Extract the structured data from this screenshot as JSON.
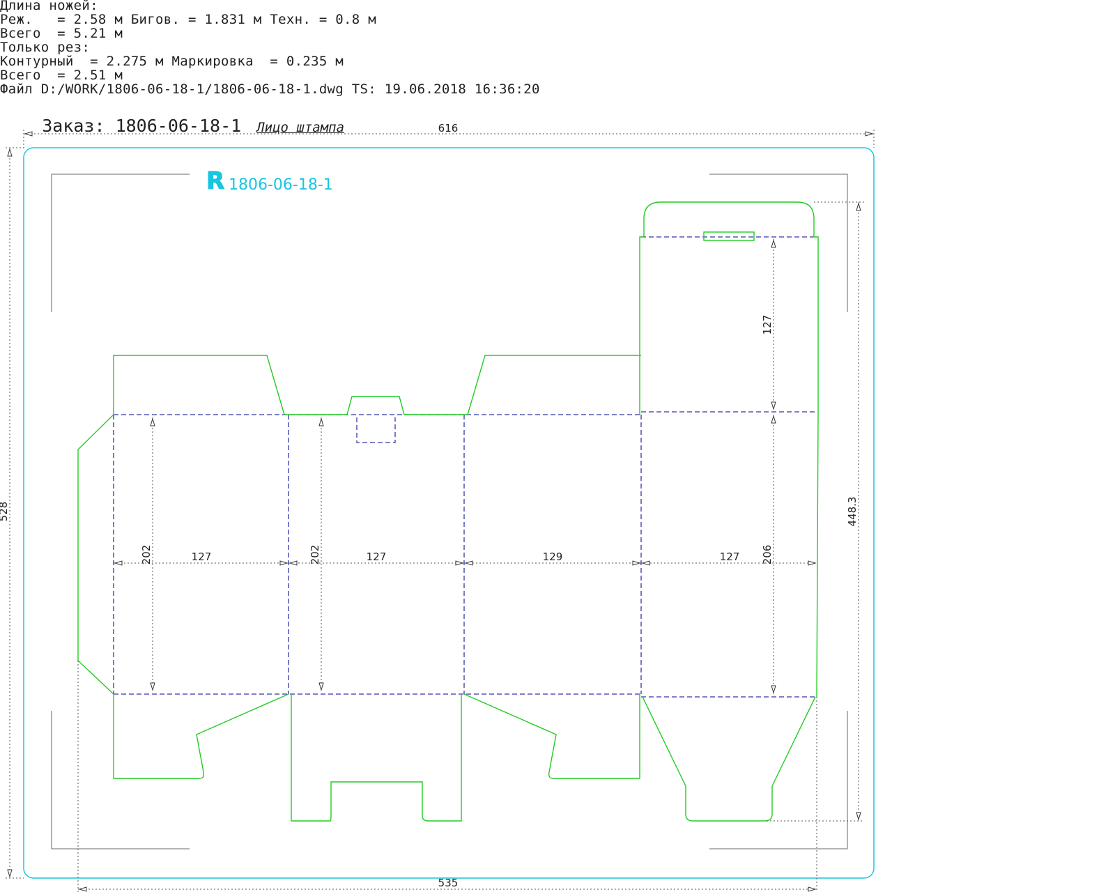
{
  "header": {
    "lines": [
      "Длина ножей:",
      "Реж.   = 2.58 м Бигов. = 1.831 м Техн. = 0.8 м",
      "Всего  = 5.21 м",
      "Только рез:",
      "Контурный  = 2.275 м Маркировка  = 0.235 м",
      "Всего  = 2.51 м",
      "Файл D:/WORK/1806-06-18-1/1806-06-18-1.dwg TS: 19.06.2018 16:36:20"
    ],
    "order_label": "Заказ: 1806-06-18-1",
    "face_label": "Лицо штампа"
  },
  "stamp": {
    "logo_letter": "R",
    "code": "1806-06-18-1"
  },
  "dimensions": {
    "overall_width": "616",
    "overall_height": "528",
    "blank_width": "535",
    "blank_height": "448.3",
    "panel_widths": [
      "127",
      "127",
      "129",
      "127"
    ],
    "panel_heights": [
      "202",
      "202",
      "206"
    ],
    "lid_height": "127"
  },
  "colors": {
    "cut_line": "#22cc22",
    "crease_line": "#3333aa",
    "border": "#19c6e0",
    "dimension": "#222222",
    "frame": "#888888"
  }
}
